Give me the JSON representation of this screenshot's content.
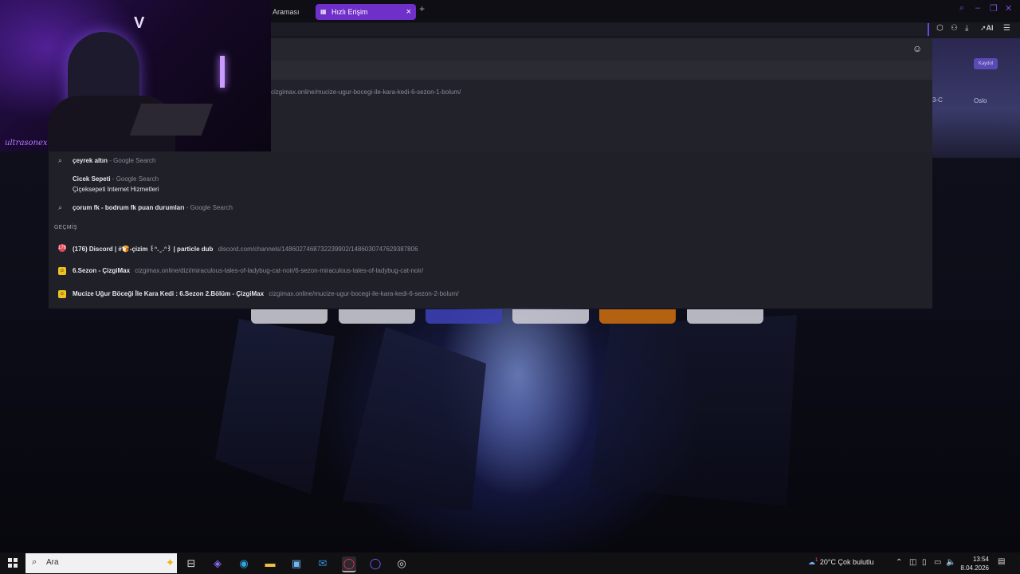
{
  "tabs": {
    "previous_label": "Araması",
    "active_label": "Hızlı Erişim",
    "close_symbol": "×",
    "new_tab_symbol": "+"
  },
  "toolbar": {
    "ai_label": "AI"
  },
  "omnibox": {
    "first_url": "cizgimax.online/mucize-ugur-bocegi-ile-kara-kedi-6-sezon-1-bolum/",
    "suggestions": [
      {
        "bold": "çeyrek altın",
        "dim": " - Google Search"
      },
      {
        "bold": "Cicek Sepeti",
        "dim": " - Google Search",
        "sub": "Çiçeksepeti Internet Hizmetleri"
      },
      {
        "bold": "çorum fk - bodrum fk puan durumları",
        "dim": " - Google Search"
      }
    ],
    "history_header": "GEÇMİŞ",
    "history": [
      {
        "badge": "176",
        "title": "(176) Discord | #🍞-çizim ꒰ᐢ. ̫ .ᐢ꒱ | particle dub",
        "url": "discord.com/channels/1486027468732239902/1486030747629387806"
      },
      {
        "title": "6.Sezon - ÇizgiMax",
        "url": "cizgimax.online/dizi/miraculous-tales-of-ladybug-cat-noir/6-sezon-miraculous-tales-of-ladybug-cat-noir/"
      },
      {
        "title": "Mucize Uğur Böceği İle Kara Kedi : 6.Sezon 2.Bölüm - ÇizgiMax",
        "url": "cizgimax.online/mucize-ugur-bocegi-ile-kara-kedi-6-sezon-2-bolum/"
      }
    ]
  },
  "right_page": {
    "button": "Kaydol",
    "text1": "3-C",
    "text2": "Oslo"
  },
  "webcam": {
    "signature": "ultrasonex"
  },
  "taskbar": {
    "search_placeholder": "Ara",
    "weather": "20°C  Çok bulutlu",
    "weather_badge": "1",
    "time": "13:54",
    "date": "8.04.2026"
  },
  "colors": {
    "accent": "#6f2fc9",
    "url_dim": "#8a8a98"
  }
}
